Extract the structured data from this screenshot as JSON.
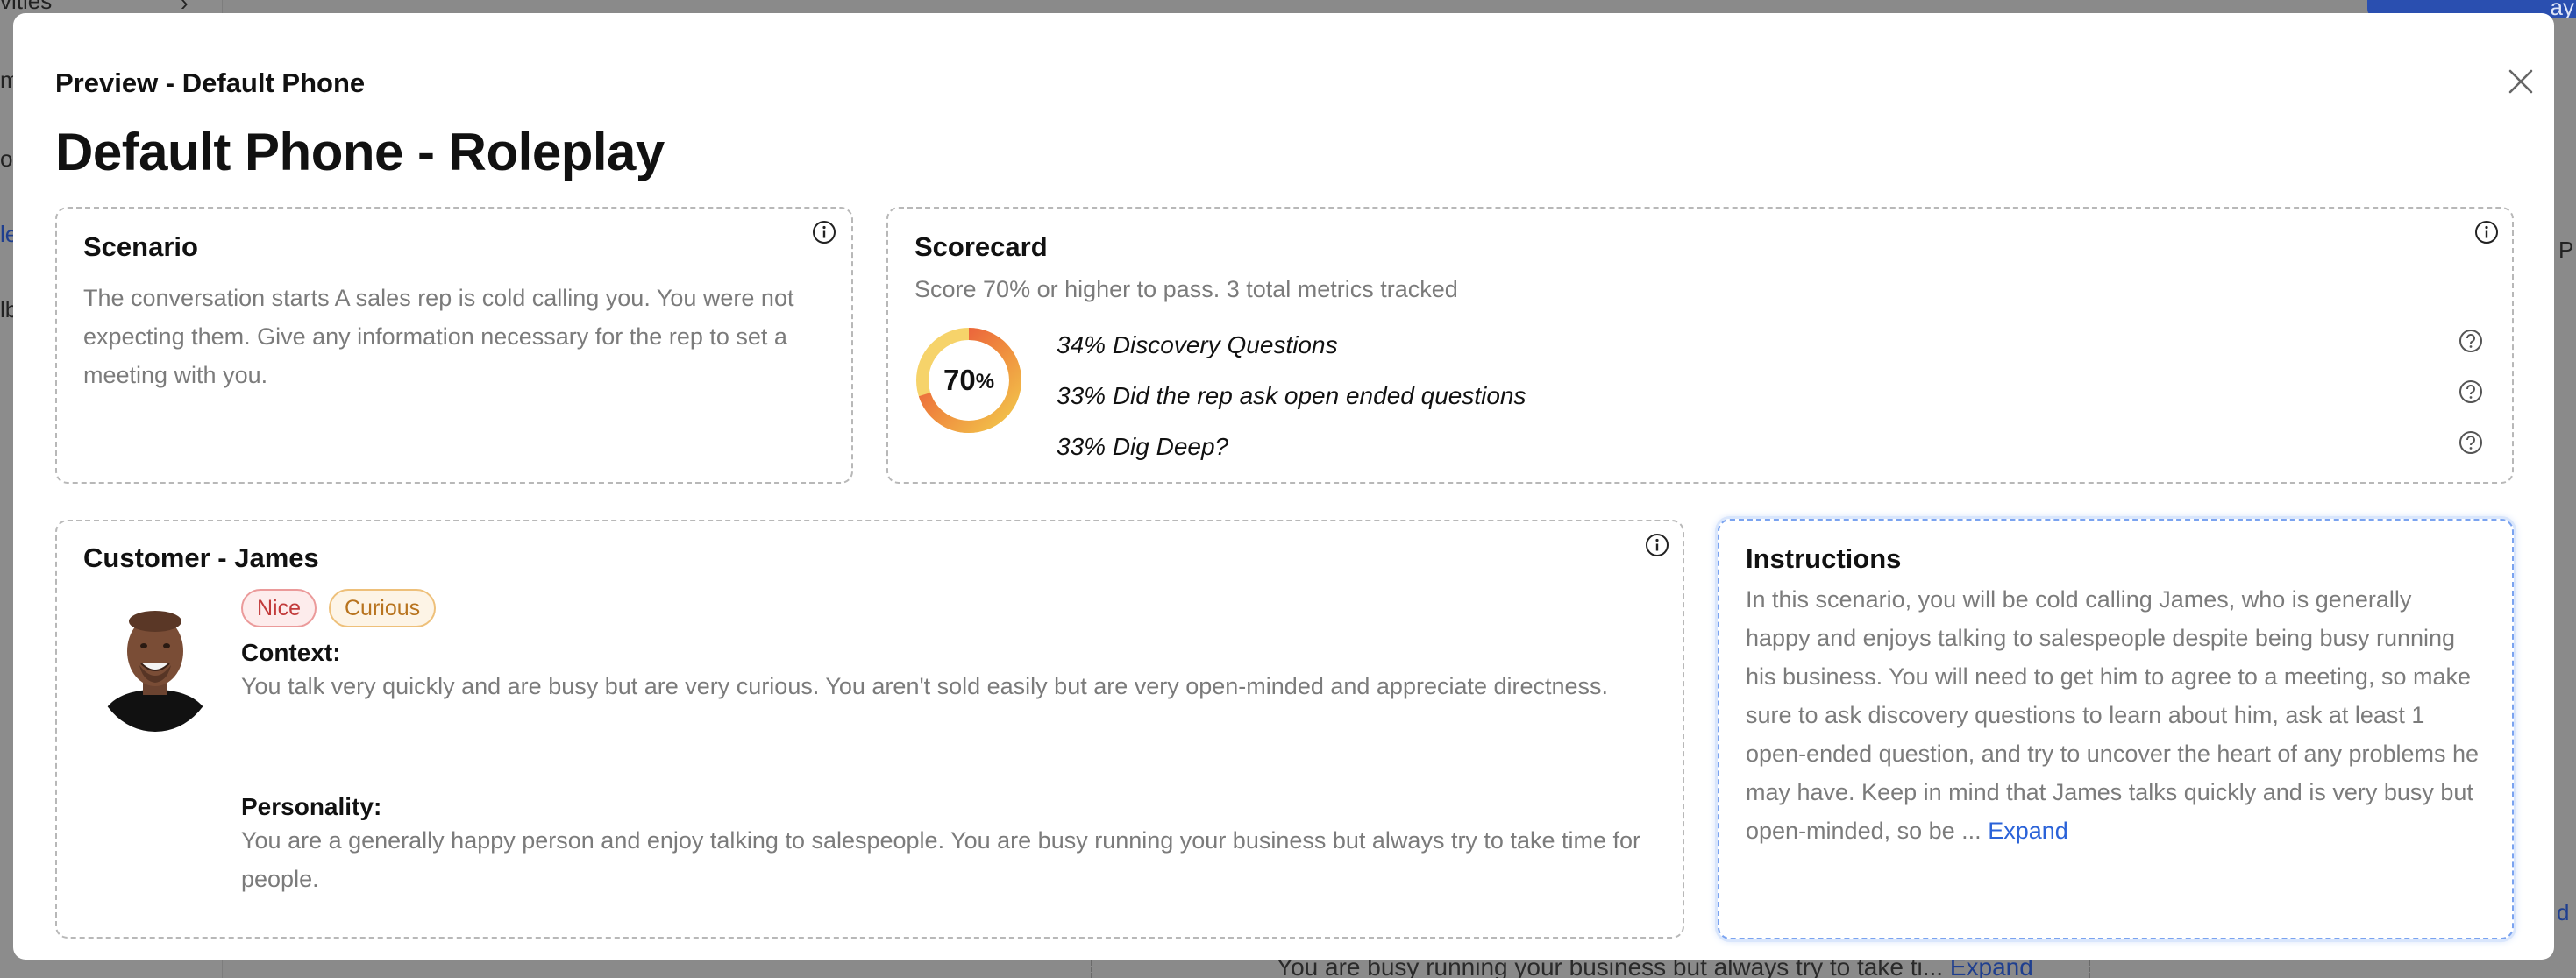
{
  "background": {
    "sidebar_fragments": [
      "vities",
      "m",
      "o",
      "le",
      "lb"
    ],
    "right_button_fragment": "ay",
    "right_fragments": [
      "P",
      "d"
    ],
    "bottom_text": "You are busy running your business but always try to take ti...",
    "bottom_expand": "Expand"
  },
  "modal": {
    "preview_label": "Preview - Default Phone",
    "title": "Default Phone - Roleplay"
  },
  "scenario": {
    "title": "Scenario",
    "text": "The conversation starts A sales rep is cold calling you. You were not expecting them. Give any information necessary for the rep to set a meeting with you."
  },
  "scorecard": {
    "title": "Scorecard",
    "subtitle": "Score 70% or higher to pass. 3 total metrics tracked",
    "pass_score": "70",
    "pass_unit": "%",
    "pass_fraction": 0.7,
    "metrics": [
      {
        "label": "34% Discovery Questions"
      },
      {
        "label": "33% Did the rep ask open ended questions"
      },
      {
        "label": "33% Dig Deep?"
      }
    ]
  },
  "customer": {
    "title": "Customer - James",
    "tags": [
      "Nice",
      "Curious"
    ],
    "context_label": "Context:",
    "context_text": "You talk very quickly and are busy but are very curious. You aren't sold easily but are very open-minded and appreciate directness.",
    "personality_label": "Personality:",
    "personality_text": "You are a generally happy person and enjoy talking to salespeople. You are busy running your business but always try to take time for people."
  },
  "instructions": {
    "title": "Instructions",
    "text": "In this scenario, you will be cold calling James, who is generally happy and enjoys talking to salespeople despite being busy running his business. You will need to get him to agree to a meeting, so make sure to ask discovery questions to learn about him, ask at least 1 open-ended question, and try to uncover the heart of any problems he may have. Keep in mind that James talks quickly and is very busy but open-minded, so be ...",
    "expand": "Expand"
  },
  "colors": {
    "accent_link": "#2a62d8",
    "donut_red": "#e8473a",
    "donut_yellow": "#f2c94c",
    "tag_nice": "#c23b3b",
    "tag_curious": "#b8741f"
  }
}
